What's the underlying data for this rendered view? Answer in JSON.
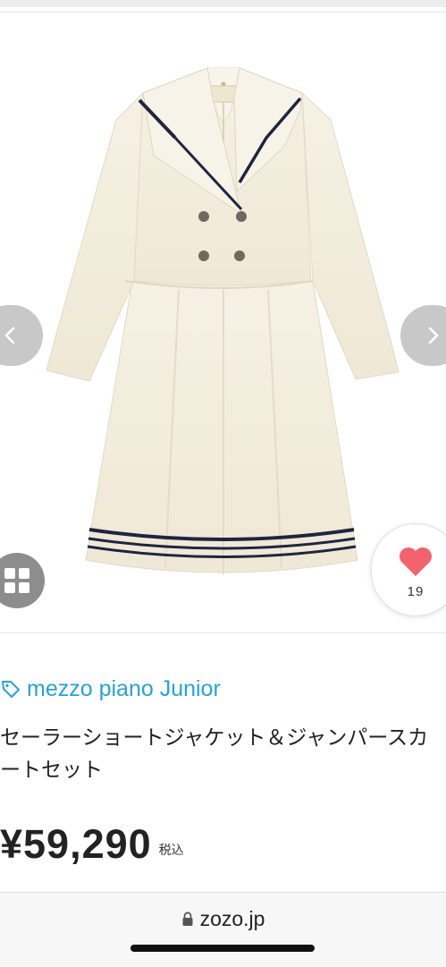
{
  "product": {
    "brand": "mezzo piano Junior",
    "title": "セーラーショートジャケット＆ジャンパースカートセット",
    "price": "¥59,290",
    "tax_label": "税込",
    "likes": "19",
    "image_icon": "sailor-jacket-jumper-skirt-set"
  },
  "browser": {
    "url": "zozo.jp"
  },
  "icons": {
    "prev": "chevron-left-icon",
    "next": "chevron-right-icon",
    "grid": "grid-icon",
    "heart": "heart-icon",
    "tag": "tag-icon",
    "lock": "lock-icon"
  },
  "colors": {
    "brand_link": "#2aa1d6",
    "heart": "#f2636e",
    "garment": "#f4efe1",
    "navy_trim": "#1f2540"
  }
}
